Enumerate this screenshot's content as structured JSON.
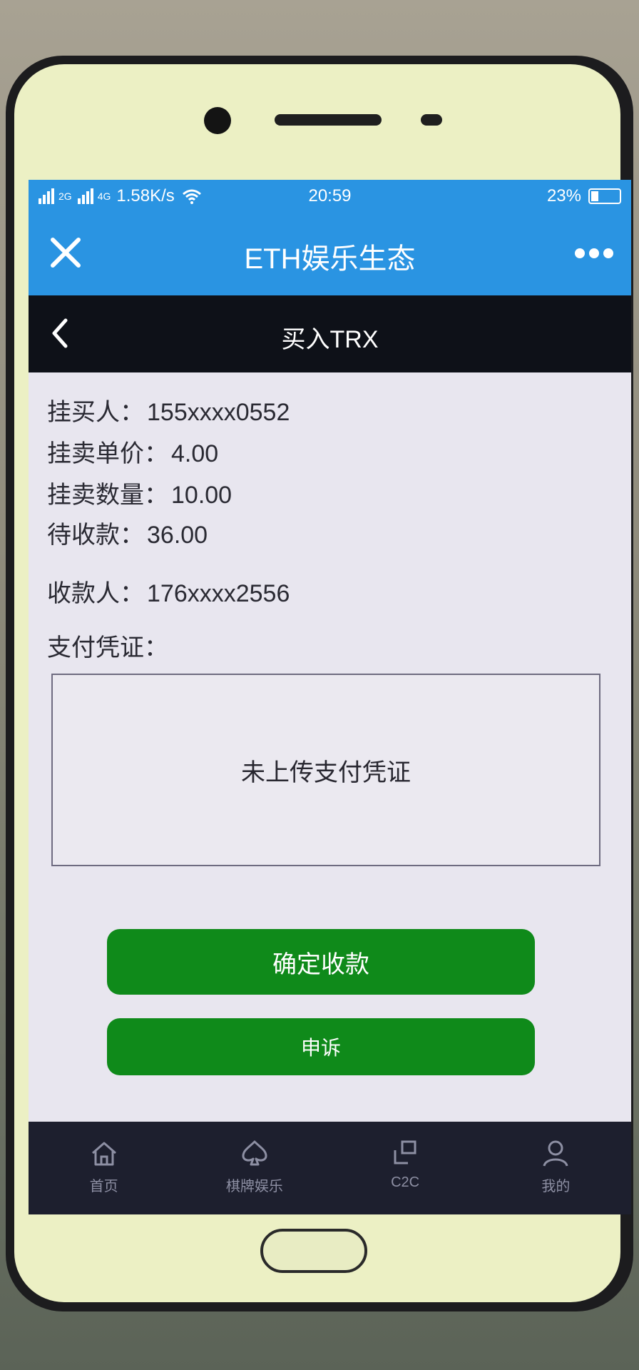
{
  "status_bar": {
    "network_left": "2G",
    "network_right": "4G",
    "speed": "1.58K/s",
    "time": "20:59",
    "battery": "23%"
  },
  "app": {
    "title": "ETH娱乐生态"
  },
  "nav": {
    "title": "买入TRX"
  },
  "order": {
    "buyer_label": "挂买人：",
    "buyer_value": "155xxxx0552",
    "unit_price_label": "挂卖单价：",
    "unit_price_value": "4.00",
    "quantity_label": "挂卖数量：",
    "quantity_value": "10.00",
    "pending_label": "待收款：",
    "pending_value": "36.00",
    "payee_label": "收款人：",
    "payee_value": "176xxxx2556",
    "proof_label": "支付凭证：",
    "proof_empty": "未上传支付凭证"
  },
  "buttons": {
    "confirm": "确定收款",
    "appeal": "申诉"
  },
  "tabs": [
    {
      "label": "首页",
      "icon": "home-icon"
    },
    {
      "label": "棋牌娱乐",
      "icon": "spade-icon"
    },
    {
      "label": "C2C",
      "icon": "exchange-icon"
    },
    {
      "label": "我的",
      "icon": "user-icon"
    }
  ],
  "colors": {
    "header_blue": "#2a94e2",
    "nav_dark": "#0e1118",
    "button_green": "#0f8a1a",
    "tab_bar": "#1d1f2e"
  }
}
